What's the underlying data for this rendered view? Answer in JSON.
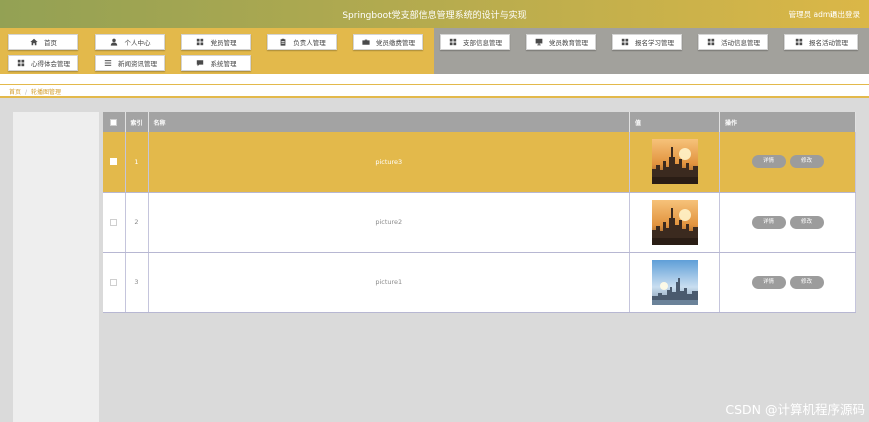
{
  "header": {
    "title": "Springboot党支部信息管理系统的设计与实现",
    "user_label": "管理员 admin",
    "logout_label": "退出登录"
  },
  "nav": {
    "items": [
      {
        "label": "首页",
        "icon": "home-icon"
      },
      {
        "label": "个人中心",
        "icon": "user-icon"
      },
      {
        "label": "党员管理",
        "icon": "grid-icon"
      },
      {
        "label": "负责人管理",
        "icon": "clipboard-icon"
      },
      {
        "label": "党员缴费管理",
        "icon": "briefcase-icon"
      },
      {
        "label": "支部信息管理",
        "icon": "grid-icon"
      },
      {
        "label": "党员教育管理",
        "icon": "monitor-icon"
      },
      {
        "label": "报名学习管理",
        "icon": "grid-icon"
      },
      {
        "label": "活动信息管理",
        "icon": "grid-icon"
      },
      {
        "label": "报名活动管理",
        "icon": "grid-icon"
      },
      {
        "label": "心得体会管理",
        "icon": "grid-icon"
      },
      {
        "label": "新闻资讯管理",
        "icon": "list-icon"
      },
      {
        "label": "系统管理",
        "icon": "chat-icon"
      }
    ]
  },
  "breadcrumb": {
    "home": "首页",
    "separator": "/",
    "current": "轮播图管理"
  },
  "table": {
    "headers": {
      "index": "索引",
      "name": "名称",
      "value": "值",
      "ops": "操作"
    },
    "rows": [
      {
        "index": "1",
        "name": "picture3",
        "selected": true,
        "image": "city-sunset"
      },
      {
        "index": "2",
        "name": "picture2",
        "selected": false,
        "image": "city-sunset"
      },
      {
        "index": "3",
        "name": "picture1",
        "selected": false,
        "image": "city-daylight"
      }
    ],
    "detail_label": "详情",
    "edit_label": "修改"
  },
  "watermark": "CSDN @计算机程序源码",
  "colors": {
    "accent_gold": "#e3b94b",
    "nav_gray": "#a2a19c",
    "header_gradient_start": "#93a154",
    "button_gray": "#9c9c9c"
  }
}
